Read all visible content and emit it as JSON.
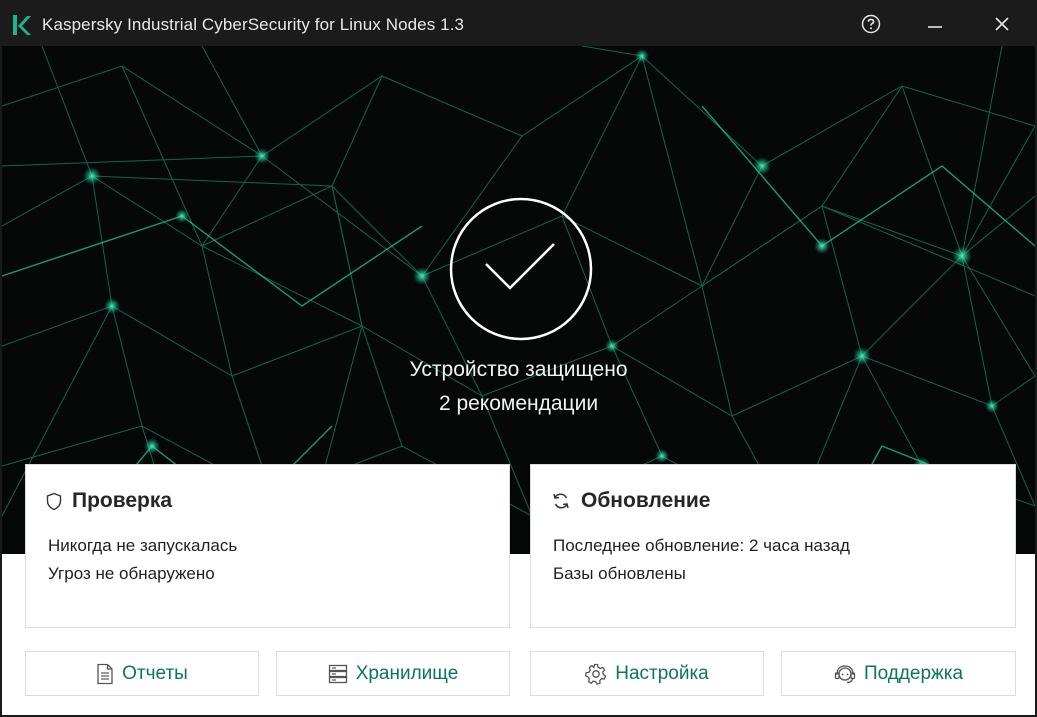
{
  "window": {
    "title": "Kaspersky Industrial CyberSecurity for Linux Nodes 1.3",
    "accent_color": "#1fb38c",
    "link_color": "#0b7560"
  },
  "titlebar_icons": [
    "help-icon",
    "minimize-icon",
    "close-icon"
  ],
  "status": {
    "line1": "Устройство защищено",
    "line2": "2 рекомендации",
    "icon": "checkmark-icon"
  },
  "cards": {
    "scan": {
      "title": "Проверка",
      "icon": "shield-icon",
      "line1": "Никогда не запускалась",
      "line2": "Угроз не обнаружено"
    },
    "update": {
      "title": "Обновление",
      "icon": "refresh-icon",
      "line1": "Последнее обновление: 2 часа назад",
      "line2": "Базы обновлены"
    }
  },
  "buttons": {
    "reports": {
      "label": "Отчеты",
      "icon": "document-icon"
    },
    "storage": {
      "label": "Хранилище",
      "icon": "storage-icon"
    },
    "settings": {
      "label": "Настройка",
      "icon": "gear-icon"
    },
    "support": {
      "label": "Поддержка",
      "icon": "headset-icon"
    }
  }
}
